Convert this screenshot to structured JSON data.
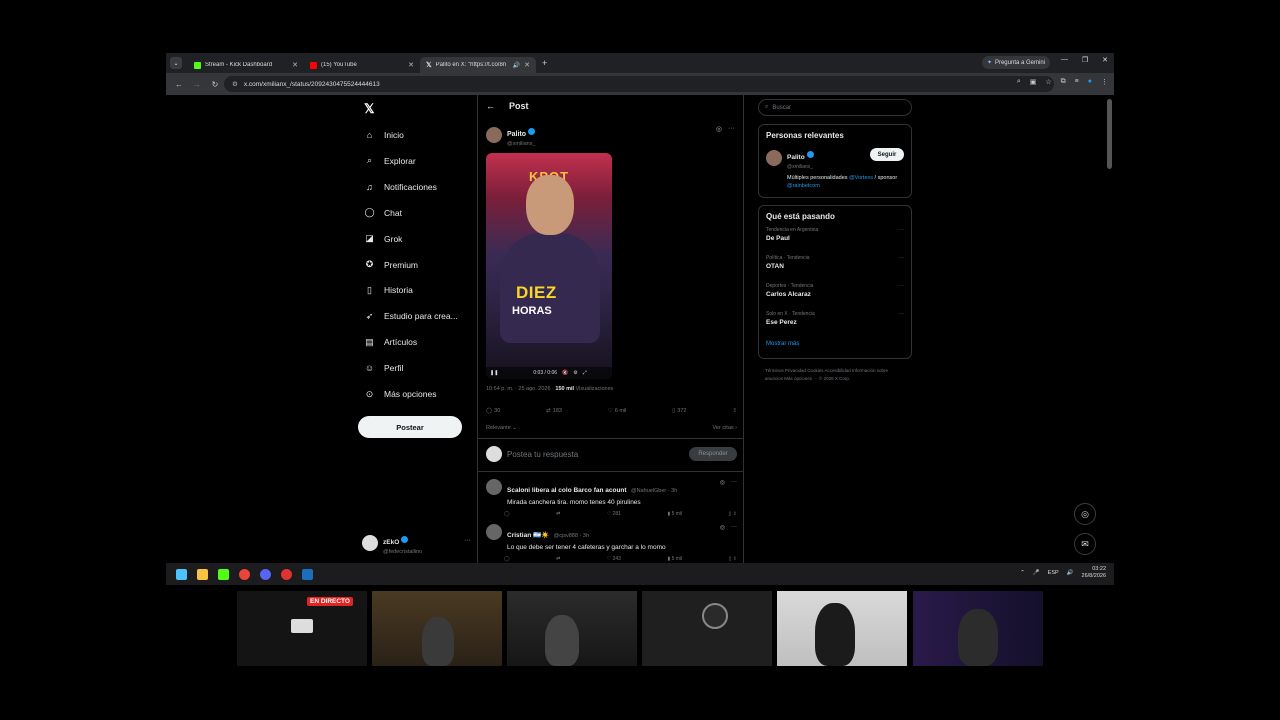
{
  "browser": {
    "tabs": [
      {
        "title": "Stream - Kick Dashboard",
        "favicon_color": "#53fc18"
      },
      {
        "title": "(15) YouTube",
        "favicon_color": "#ff0000"
      },
      {
        "title": "Palito en X: \"https://t.co/8n",
        "favicon_color": "#ffffff"
      }
    ],
    "gemini_label": "Pregunta a Gemini",
    "url": "x.com/xmilianx_/status/2092430475524444613"
  },
  "sidebar": {
    "items": [
      {
        "label": "Inicio",
        "icon": "home-icon",
        "glyph": "⌂"
      },
      {
        "label": "Explorar",
        "icon": "search-icon",
        "glyph": "⌕"
      },
      {
        "label": "Notificaciones",
        "icon": "bell-icon",
        "glyph": "♫"
      },
      {
        "label": "Chat",
        "icon": "chat-icon",
        "glyph": "◯"
      },
      {
        "label": "Grok",
        "icon": "grok-icon",
        "glyph": "◪"
      },
      {
        "label": "Premium",
        "icon": "premium-icon",
        "glyph": "✪"
      },
      {
        "label": "Historia",
        "icon": "bookmark-icon",
        "glyph": "▯"
      },
      {
        "label": "Estudio para crea...",
        "icon": "rocket-icon",
        "glyph": "➶"
      },
      {
        "label": "Artículos",
        "icon": "article-icon",
        "glyph": "▤"
      },
      {
        "label": "Perfil",
        "icon": "profile-icon",
        "glyph": "☺"
      },
      {
        "label": "Más opciones",
        "icon": "more-icon",
        "glyph": "⊙"
      }
    ],
    "post_button": "Postear",
    "account": {
      "name": "zEkO",
      "handle": "@fedecristallino"
    }
  },
  "main": {
    "header": "Post",
    "author": {
      "name": "Palito",
      "handle": "@xmilianx_"
    },
    "video": {
      "banner": "KPOT",
      "line1": "DIEZ",
      "line2": "HORAS",
      "time": "0:03 / 0:06"
    },
    "meta": {
      "time": "10:54 p. m. · 25 ago. 2026 ·",
      "views": "150 mil",
      "views_label": "Visualizaciones"
    },
    "stats": {
      "replies": "30",
      "reposts": "183",
      "likes": "6 mil",
      "bookmarks": "372"
    },
    "sort_label": "Relevante ⌄",
    "quotes_label": "Ver citas ›",
    "composer_placeholder": "Postea tu respuesta",
    "reply_button": "Responder",
    "replies": [
      {
        "name": "Scaloni libera al colo Barco fan acount",
        "handle": "@NahuelGber · 3h",
        "text": "Mirada canchera tira. momo tenes 40 pirulines",
        "likes": "281",
        "views": "5 mil"
      },
      {
        "name": "Cristian 🇦🇷☀️",
        "handle": "@cjsv888 · 3h",
        "text": "Lo que debe ser tener 4 cafeteras y garchar a lo momo",
        "likes": "243",
        "views": "5 mil"
      }
    ]
  },
  "right": {
    "search_placeholder": "Buscar",
    "relevant": {
      "title": "Personas relevantes",
      "name": "Palito",
      "handle": "@xmilianx_",
      "follow": "Seguir",
      "bio_text": "Múltiples personalidades",
      "bio_link1": "@Vortexs",
      "bio_sep": " / sponsor",
      "bio_link2": "@rainbetcom"
    },
    "trending": {
      "title": "Qué está pasando",
      "items": [
        {
          "category": "Tendencia en Argentina",
          "name": "De Paul"
        },
        {
          "category": "Política · Tendencia",
          "name": "OTAN"
        },
        {
          "category": "Deportes · Tendencia",
          "name": "Carlos Alcaraz"
        },
        {
          "category": "Solo en X · Tendencia",
          "name": "Ese Perez"
        }
      ],
      "show_more": "Mostrar más"
    },
    "footer": "Términos    Privacidad    Cookies    Accesibilidad    Información sobre anuncios    Más opciones ···    © 2026 X Corp."
  },
  "taskbar": {
    "lang": "ESP",
    "time": "03:22",
    "date": "26/8/2026"
  },
  "stream": {
    "live_label": "EN DIRECTO"
  }
}
